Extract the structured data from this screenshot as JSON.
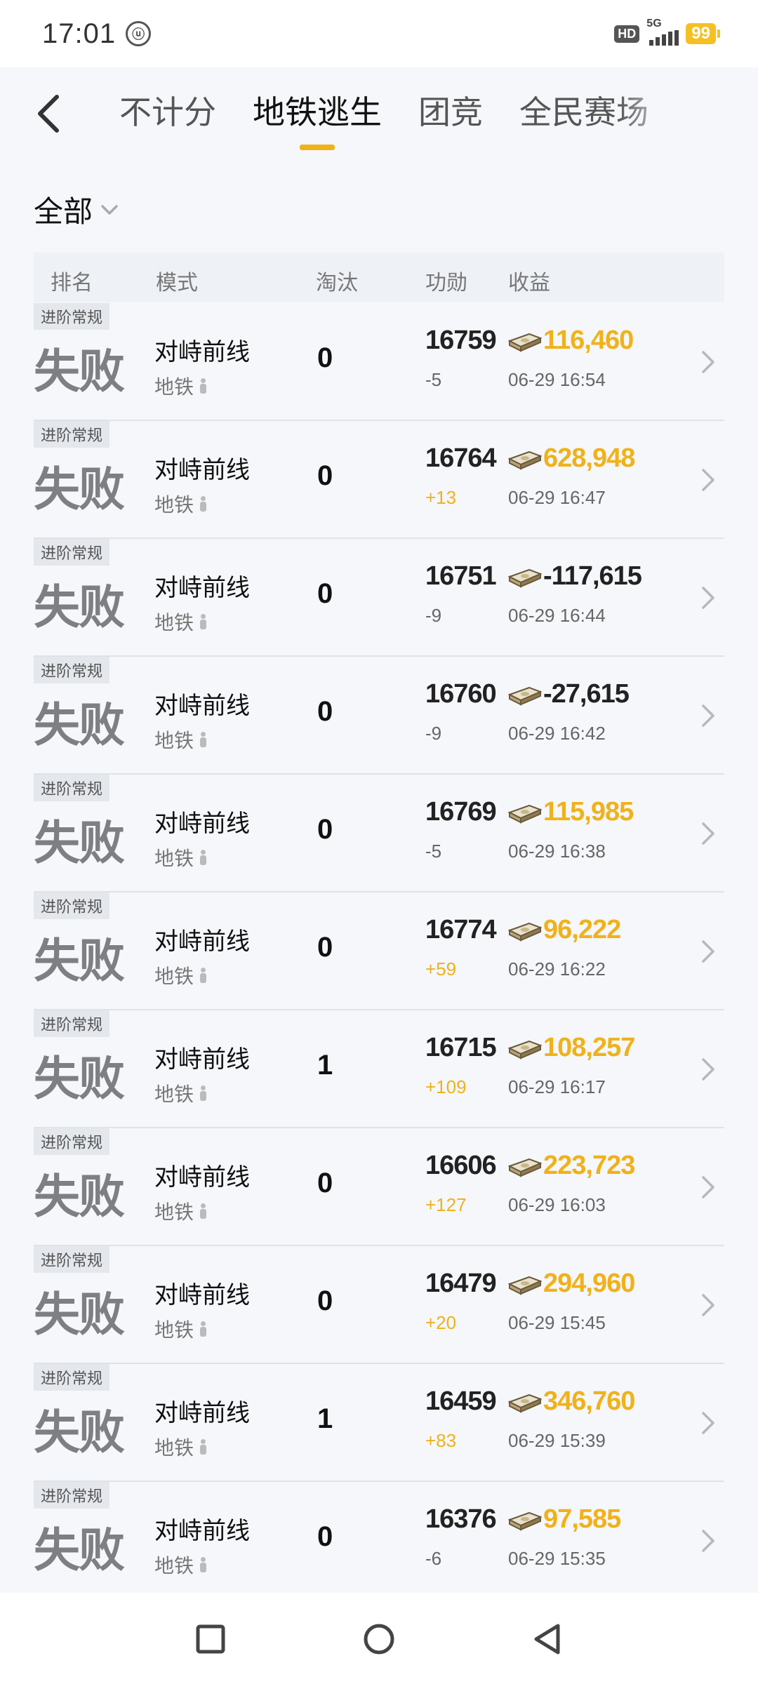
{
  "status_bar": {
    "time": "17:01",
    "hd": "HD",
    "network": "5G",
    "battery": "99"
  },
  "tabs": [
    {
      "label": "不计分",
      "active": false
    },
    {
      "label": "地铁逃生",
      "active": true
    },
    {
      "label": "团竞",
      "active": false
    },
    {
      "label": "全民赛场",
      "active": false
    }
  ],
  "filter": {
    "label": "全部"
  },
  "table_header": {
    "rank": "排名",
    "mode": "模式",
    "kills": "淘汰",
    "merit": "功勋",
    "income": "收益"
  },
  "rows": [
    {
      "tag": "进阶常规",
      "result": "失败",
      "map": "对峙前线",
      "map_type": "地铁",
      "kills": "0",
      "merit": "16759",
      "delta": "-5",
      "delta_positive": false,
      "income": "116,460",
      "income_negative": false,
      "time": "06-29 16:54"
    },
    {
      "tag": "进阶常规",
      "result": "失败",
      "map": "对峙前线",
      "map_type": "地铁",
      "kills": "0",
      "merit": "16764",
      "delta": "+13",
      "delta_positive": true,
      "income": "628,948",
      "income_negative": false,
      "time": "06-29 16:47"
    },
    {
      "tag": "进阶常规",
      "result": "失败",
      "map": "对峙前线",
      "map_type": "地铁",
      "kills": "0",
      "merit": "16751",
      "delta": "-9",
      "delta_positive": false,
      "income": "-117,615",
      "income_negative": true,
      "time": "06-29 16:44"
    },
    {
      "tag": "进阶常规",
      "result": "失败",
      "map": "对峙前线",
      "map_type": "地铁",
      "kills": "0",
      "merit": "16760",
      "delta": "-9",
      "delta_positive": false,
      "income": "-27,615",
      "income_negative": true,
      "time": "06-29 16:42"
    },
    {
      "tag": "进阶常规",
      "result": "失败",
      "map": "对峙前线",
      "map_type": "地铁",
      "kills": "0",
      "merit": "16769",
      "delta": "-5",
      "delta_positive": false,
      "income": "115,985",
      "income_negative": false,
      "time": "06-29 16:38"
    },
    {
      "tag": "进阶常规",
      "result": "失败",
      "map": "对峙前线",
      "map_type": "地铁",
      "kills": "0",
      "merit": "16774",
      "delta": "+59",
      "delta_positive": true,
      "income": "96,222",
      "income_negative": false,
      "time": "06-29 16:22"
    },
    {
      "tag": "进阶常规",
      "result": "失败",
      "map": "对峙前线",
      "map_type": "地铁",
      "kills": "1",
      "merit": "16715",
      "delta": "+109",
      "delta_positive": true,
      "income": "108,257",
      "income_negative": false,
      "time": "06-29 16:17"
    },
    {
      "tag": "进阶常规",
      "result": "失败",
      "map": "对峙前线",
      "map_type": "地铁",
      "kills": "0",
      "merit": "16606",
      "delta": "+127",
      "delta_positive": true,
      "income": "223,723",
      "income_negative": false,
      "time": "06-29 16:03"
    },
    {
      "tag": "进阶常规",
      "result": "失败",
      "map": "对峙前线",
      "map_type": "地铁",
      "kills": "0",
      "merit": "16479",
      "delta": "+20",
      "delta_positive": true,
      "income": "294,960",
      "income_negative": false,
      "time": "06-29 15:45"
    },
    {
      "tag": "进阶常规",
      "result": "失败",
      "map": "对峙前线",
      "map_type": "地铁",
      "kills": "1",
      "merit": "16459",
      "delta": "+83",
      "delta_positive": true,
      "income": "346,760",
      "income_negative": false,
      "time": "06-29 15:39"
    },
    {
      "tag": "进阶常规",
      "result": "失败",
      "map": "对峙前线",
      "map_type": "地铁",
      "kills": "0",
      "merit": "16376",
      "delta": "-6",
      "delta_positive": false,
      "income": "97,585",
      "income_negative": false,
      "time": "06-29 15:35"
    }
  ],
  "colors": {
    "accent": "#f0b21a",
    "background": "#f5f7fa",
    "result_gray": "#7d7f82"
  }
}
